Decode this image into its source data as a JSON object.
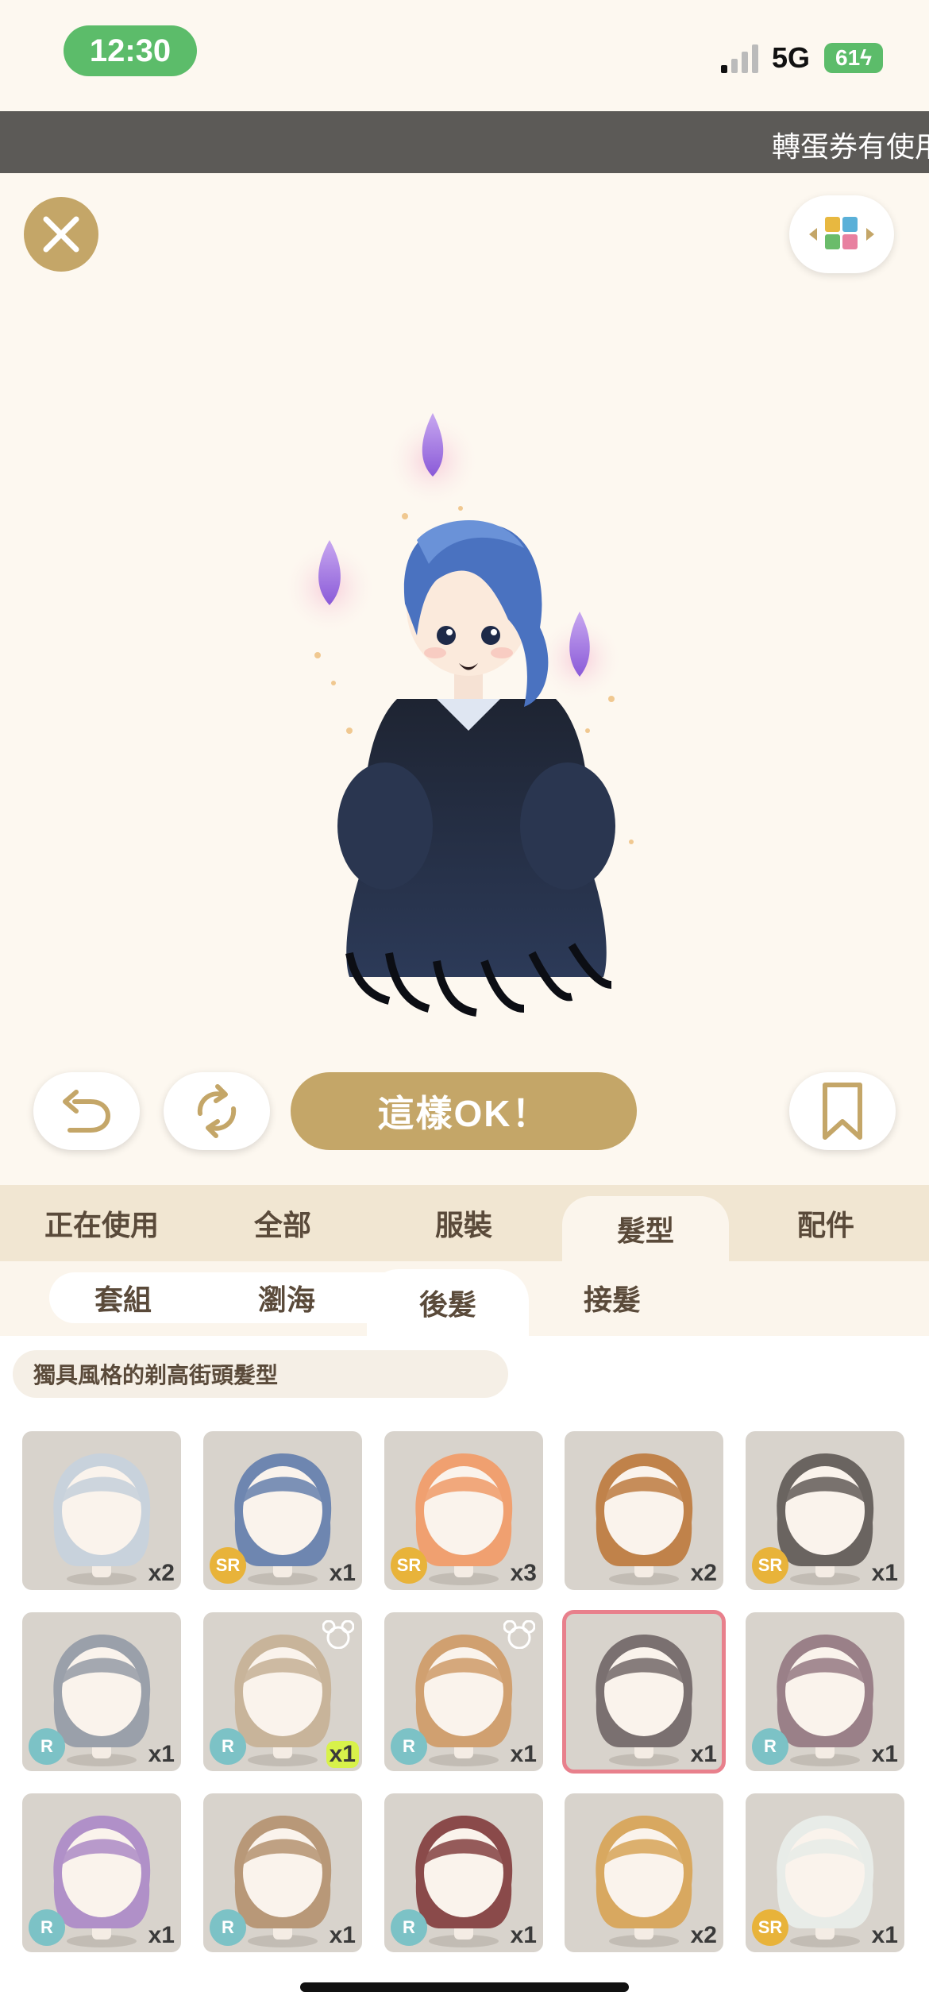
{
  "status": {
    "time": "12:30",
    "network": "5G",
    "battery": "61"
  },
  "marquee": {
    "text": "轉蛋券有使用"
  },
  "actions": {
    "ok_label": "這樣OK！"
  },
  "main_tabs": [
    "正在使用",
    "全部",
    "服裝",
    "髮型",
    "配件"
  ],
  "main_tab_active": "髮型",
  "sub_tabs": [
    "套組",
    "瀏海",
    "後髮",
    "接髮"
  ],
  "sub_tab_active": "後髮",
  "description": "獨具風格的剃高街頭髮型",
  "items": [
    {
      "rarity": "",
      "count": "x2",
      "hair": "#c8d2dc"
    },
    {
      "rarity": "SR",
      "count": "x1",
      "hair": "#6e86b0"
    },
    {
      "rarity": "SR",
      "count": "x3",
      "hair": "#f0a070"
    },
    {
      "rarity": "",
      "count": "x2",
      "hair": "#c0824a"
    },
    {
      "rarity": "SR",
      "count": "x1",
      "hair": "#6a6460"
    },
    {
      "rarity": "R",
      "count": "x1",
      "hair": "#9aa0aa"
    },
    {
      "rarity": "R",
      "count": "x1",
      "hair": "#c8b49a"
    },
    {
      "rarity": "R",
      "count": "x1",
      "hair": "#d0a070"
    },
    {
      "rarity": "",
      "count": "x1",
      "hair": "#7a7070"
    },
    {
      "rarity": "R",
      "count": "x1",
      "hair": "#9a8088"
    },
    {
      "rarity": "R",
      "count": "x1",
      "hair": "#b090c8"
    },
    {
      "rarity": "R",
      "count": "x1",
      "hair": "#b89878"
    },
    {
      "rarity": "R",
      "count": "x1",
      "hair": "#8a4a4a"
    },
    {
      "rarity": "",
      "count": "x2",
      "hair": "#d8a860"
    },
    {
      "rarity": "SR",
      "count": "x1",
      "hair": "#e8ece8"
    }
  ]
}
